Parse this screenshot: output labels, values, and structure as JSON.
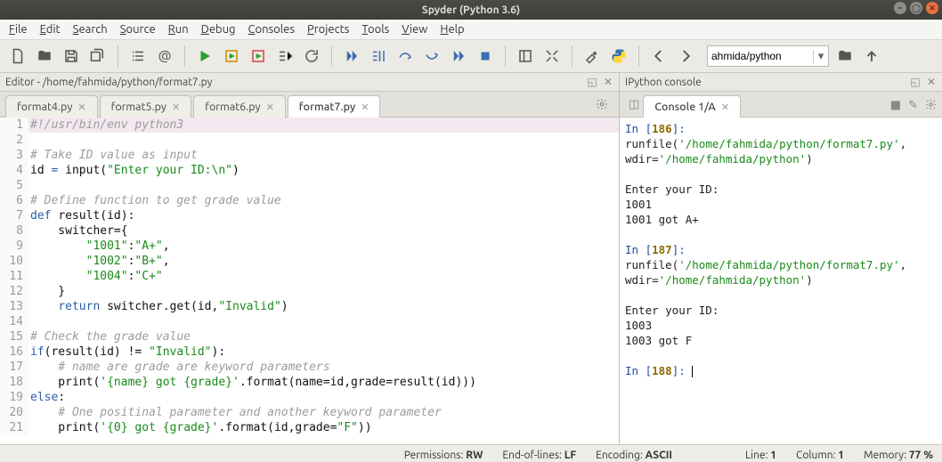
{
  "window": {
    "title": "Spyder (Python 3.6)"
  },
  "menu": [
    "File",
    "Edit",
    "Search",
    "Source",
    "Run",
    "Debug",
    "Consoles",
    "Projects",
    "Tools",
    "View",
    "Help"
  ],
  "address": {
    "value": "ahmida/python"
  },
  "editor": {
    "title": "Editor - /home/fahmida/python/format7.py",
    "tabs": [
      {
        "label": "format4.py",
        "active": false
      },
      {
        "label": "format5.py",
        "active": false
      },
      {
        "label": "format6.py",
        "active": false
      },
      {
        "label": "format7.py",
        "active": true
      }
    ],
    "lines": [
      {
        "n": 1,
        "hl": true,
        "seg": [
          {
            "c": "c-comment",
            "t": "#!/usr/bin/env python3"
          }
        ]
      },
      {
        "n": 2,
        "seg": []
      },
      {
        "n": 3,
        "seg": [
          {
            "c": "c-comment",
            "t": "# Take ID value as input"
          }
        ]
      },
      {
        "n": 4,
        "seg": [
          {
            "c": "c-id",
            "t": "id "
          },
          {
            "c": "c-kw",
            "t": "= "
          },
          {
            "c": "c-fn",
            "t": "input("
          },
          {
            "c": "c-str",
            "t": "\"Enter your ID:\\n\""
          },
          {
            "c": "c-fn",
            "t": ")"
          }
        ]
      },
      {
        "n": 5,
        "seg": []
      },
      {
        "n": 6,
        "seg": [
          {
            "c": "c-comment",
            "t": "# Define function to get grade value"
          }
        ]
      },
      {
        "n": 7,
        "seg": [
          {
            "c": "c-def",
            "t": "def "
          },
          {
            "c": "c-fn",
            "t": "result"
          },
          {
            "c": "c-id",
            "t": "(id):"
          }
        ]
      },
      {
        "n": 8,
        "seg": [
          {
            "c": "c-id",
            "t": "    switcher={"
          }
        ]
      },
      {
        "n": 9,
        "seg": [
          {
            "c": "c-id",
            "t": "        "
          },
          {
            "c": "c-str",
            "t": "\"1001\""
          },
          {
            "c": "c-id",
            "t": ":"
          },
          {
            "c": "c-str",
            "t": "\"A+\""
          },
          {
            "c": "c-id",
            "t": ","
          }
        ]
      },
      {
        "n": 10,
        "seg": [
          {
            "c": "c-id",
            "t": "        "
          },
          {
            "c": "c-str",
            "t": "\"1002\""
          },
          {
            "c": "c-id",
            "t": ":"
          },
          {
            "c": "c-str",
            "t": "\"B+\""
          },
          {
            "c": "c-id",
            "t": ","
          }
        ]
      },
      {
        "n": 11,
        "seg": [
          {
            "c": "c-id",
            "t": "        "
          },
          {
            "c": "c-str",
            "t": "\"1004\""
          },
          {
            "c": "c-id",
            "t": ":"
          },
          {
            "c": "c-str",
            "t": "\"C+\""
          }
        ]
      },
      {
        "n": 12,
        "seg": [
          {
            "c": "c-id",
            "t": "    }"
          }
        ]
      },
      {
        "n": 13,
        "seg": [
          {
            "c": "c-id",
            "t": "    "
          },
          {
            "c": "c-def",
            "t": "return "
          },
          {
            "c": "c-id",
            "t": "switcher.get(id,"
          },
          {
            "c": "c-str",
            "t": "\"Invalid\""
          },
          {
            "c": "c-id",
            "t": ")"
          }
        ]
      },
      {
        "n": 14,
        "seg": []
      },
      {
        "n": 15,
        "seg": [
          {
            "c": "c-comment",
            "t": "# Check the grade value"
          }
        ]
      },
      {
        "n": 16,
        "seg": [
          {
            "c": "c-def",
            "t": "if"
          },
          {
            "c": "c-id",
            "t": "(result(id) != "
          },
          {
            "c": "c-str",
            "t": "\"Invalid\""
          },
          {
            "c": "c-id",
            "t": "):"
          }
        ]
      },
      {
        "n": 17,
        "seg": [
          {
            "c": "c-id",
            "t": "    "
          },
          {
            "c": "c-comment",
            "t": "# name are grade are keyword parameters"
          }
        ]
      },
      {
        "n": 18,
        "seg": [
          {
            "c": "c-id",
            "t": "    print("
          },
          {
            "c": "c-str",
            "t": "'{name} got {grade}'"
          },
          {
            "c": "c-id",
            "t": ".format(name=id,grade=result(id)))"
          }
        ]
      },
      {
        "n": 19,
        "seg": [
          {
            "c": "c-def",
            "t": "else"
          },
          {
            "c": "c-id",
            "t": ":"
          }
        ]
      },
      {
        "n": 20,
        "seg": [
          {
            "c": "c-id",
            "t": "    "
          },
          {
            "c": "c-comment",
            "t": "# One positinal parameter and another keyword parameter"
          }
        ]
      },
      {
        "n": 21,
        "seg": [
          {
            "c": "c-id",
            "t": "    print("
          },
          {
            "c": "c-str",
            "t": "'{0} got {grade}'"
          },
          {
            "c": "c-id",
            "t": ".format(id,grade="
          },
          {
            "c": "c-str",
            "t": "\"F\""
          },
          {
            "c": "c-id",
            "t": "))"
          }
        ]
      }
    ]
  },
  "console": {
    "title": "IPython console",
    "tab": "Console 1/A",
    "lines": [
      {
        "type": "in",
        "n": "186",
        "seg": [
          {
            "c": "con-txt",
            "t": "runfile("
          },
          {
            "c": "con-str",
            "t": "'/home/fahmida/python/format7.py'"
          },
          {
            "c": "con-txt",
            "t": ", wdir="
          },
          {
            "c": "con-str",
            "t": "'/home/fahmida/python'"
          },
          {
            "c": "con-txt",
            "t": ")"
          }
        ]
      },
      {
        "type": "blank"
      },
      {
        "type": "out",
        "t": "Enter your ID:"
      },
      {
        "type": "out",
        "t": "1001"
      },
      {
        "type": "out",
        "t": "1001 got A+"
      },
      {
        "type": "blank"
      },
      {
        "type": "in",
        "n": "187",
        "seg": [
          {
            "c": "con-txt",
            "t": "runfile("
          },
          {
            "c": "con-str",
            "t": "'/home/fahmida/python/format7.py'"
          },
          {
            "c": "con-txt",
            "t": ", wdir="
          },
          {
            "c": "con-str",
            "t": "'/home/fahmida/python'"
          },
          {
            "c": "con-txt",
            "t": ")"
          }
        ]
      },
      {
        "type": "blank"
      },
      {
        "type": "out",
        "t": "Enter your ID:"
      },
      {
        "type": "out",
        "t": "1003"
      },
      {
        "type": "out",
        "t": "1003 got F"
      },
      {
        "type": "blank"
      },
      {
        "type": "prompt",
        "n": "188"
      }
    ]
  },
  "status": {
    "perm_label": "Permissions:",
    "perm": "RW",
    "eol_label": "End-of-lines:",
    "eol": "LF",
    "enc_label": "Encoding:",
    "enc": "ASCII",
    "line_label": "Line:",
    "line": "1",
    "col_label": "Column:",
    "col": "1",
    "mem_label": "Memory:",
    "mem": "77 %"
  }
}
